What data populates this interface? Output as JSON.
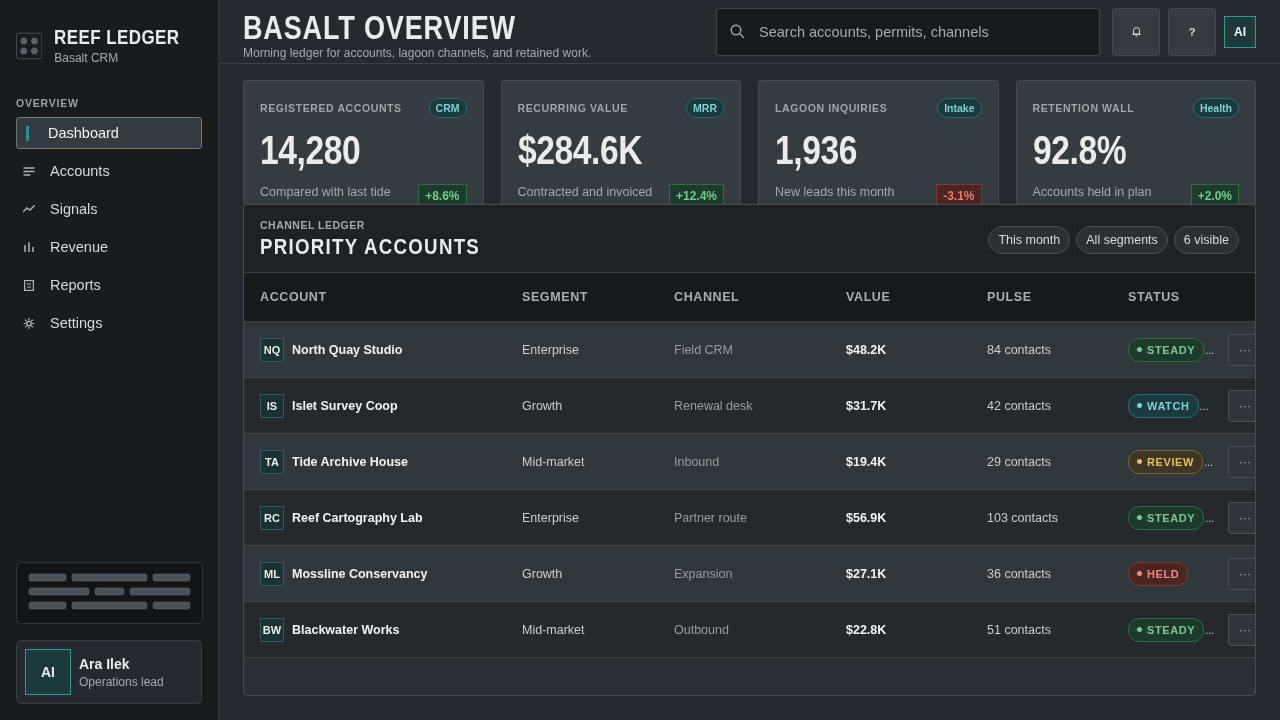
{
  "brand": {
    "title": "REEF LEDGER",
    "subtitle": "Basalt CRM"
  },
  "sidebar": {
    "section": "OVERVIEW",
    "items": [
      {
        "label": "Dashboard",
        "selected": true
      },
      {
        "label": "Accounts",
        "selected": false
      },
      {
        "label": "Signals",
        "selected": false
      },
      {
        "label": "Revenue",
        "selected": false
      },
      {
        "label": "Reports",
        "selected": false
      },
      {
        "label": "Settings",
        "selected": false
      }
    ]
  },
  "user": {
    "initials": "AI",
    "name": "Ara Ilek",
    "role": "Operations lead"
  },
  "header": {
    "title": "BASALT OVERVIEW",
    "subtitle": "Morning ledger for accounts, lagoon channels, and retained work.",
    "search": {
      "placeholder": "Search accounts, permits, channels"
    },
    "help": "?",
    "avatar": "AI"
  },
  "cards": [
    {
      "label": "REGISTERED ACCOUNTS",
      "tag": "CRM",
      "value": "14,280",
      "note": "Compared with last tide",
      "delta": "+8.6%",
      "kind": "up"
    },
    {
      "label": "RECURRING VALUE",
      "tag": "MRR",
      "value": "$284.6K",
      "note": "Contracted and invoiced",
      "delta": "+12.4%",
      "kind": "up"
    },
    {
      "label": "LAGOON INQUIRIES",
      "tag": "Intake",
      "value": "1,936",
      "note": "New leads this month",
      "delta": "-3.1%",
      "kind": "down"
    },
    {
      "label": "RETENTION WALL",
      "tag": "Health",
      "value": "92.8%",
      "note": "Accounts held in plan",
      "delta": "+2.0%",
      "kind": "up"
    }
  ],
  "table": {
    "eyebrow": "CHANNEL LEDGER",
    "title": "PRIORITY ACCOUNTS",
    "filters": [
      "This month",
      "All segments",
      "6 visible"
    ],
    "columns": [
      "ACCOUNT",
      "SEGMENT",
      "CHANNEL",
      "VALUE",
      "PULSE",
      "STATUS"
    ],
    "rows": [
      {
        "initials": "NQ",
        "account": "North Quay Studio",
        "segment": "Enterprise",
        "channel": "Field CRM",
        "value": "$48.2K",
        "pulse": "84 contacts",
        "status": "STEADY",
        "kind": "steady",
        "trail": "...",
        "action": "···"
      },
      {
        "initials": "IS",
        "account": "Islet Survey Coop",
        "segment": "Growth",
        "channel": "Renewal desk",
        "value": "$31.7K",
        "pulse": "42 contacts",
        "status": "WATCH",
        "kind": "watch",
        "trail": "...",
        "action": "···"
      },
      {
        "initials": "TA",
        "account": "Tide Archive House",
        "segment": "Mid-market",
        "channel": "Inbound",
        "value": "$19.4K",
        "pulse": "29 contacts",
        "status": "REVIEW",
        "kind": "review",
        "trail": "...",
        "action": "···"
      },
      {
        "initials": "RC",
        "account": "Reef Cartography Lab",
        "segment": "Enterprise",
        "channel": "Partner route",
        "value": "$56.9K",
        "pulse": "103 contacts",
        "status": "STEADY",
        "kind": "steady",
        "trail": "...",
        "action": "···"
      },
      {
        "initials": "ML",
        "account": "Mossline Conservancy",
        "segment": "Growth",
        "channel": "Expansion",
        "value": "$27.1K",
        "pulse": "36 contacts",
        "status": "HELD",
        "kind": "held",
        "action": "···"
      },
      {
        "initials": "BW",
        "account": "Blackwater Works",
        "segment": "Mid-market",
        "channel": "Outbound",
        "value": "$22.8K",
        "pulse": "51 contacts",
        "status": "STEADY",
        "kind": "steady",
        "trail": "...",
        "action": "···"
      }
    ]
  }
}
